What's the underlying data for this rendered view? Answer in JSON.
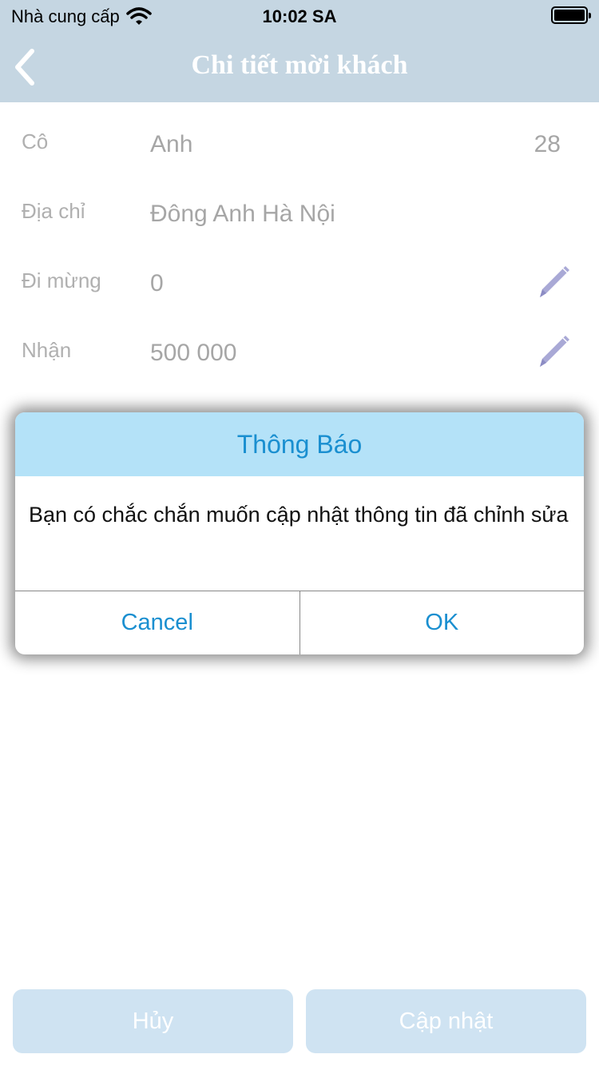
{
  "status_bar": {
    "carrier": "Nhà cung cấp",
    "time": "10:02 SA"
  },
  "nav": {
    "title": "Chi tiết mời khách"
  },
  "form": {
    "rows": [
      {
        "label": "Cô",
        "value": "Anh",
        "extra": "28"
      },
      {
        "label": "Địa chỉ",
        "value": "Đông Anh Hà Nội"
      },
      {
        "label": "Đi mừng",
        "value": "0"
      },
      {
        "label": "Nhận",
        "value": "500 000"
      }
    ]
  },
  "dialog": {
    "title": "Thông Báo",
    "message": "Bạn có chắc chắn muốn cập nhật thông tin đã chỉnh sửa",
    "cancel_label": "Cancel",
    "ok_label": "OK"
  },
  "footer": {
    "cancel_label": "Hủy",
    "update_label": "Cập nhật"
  },
  "colors": {
    "nav_bg": "#c5d6e2",
    "dialog_header_bg": "#b4e2f8",
    "accent": "#1a8fd0",
    "edit_icon": "#a9a9d6",
    "footer_button_bg": "#cfe3f2"
  },
  "icons": {
    "back": "chevron-left-icon",
    "wifi": "wifi-icon",
    "battery": "battery-icon",
    "edit": "pencil-icon"
  }
}
